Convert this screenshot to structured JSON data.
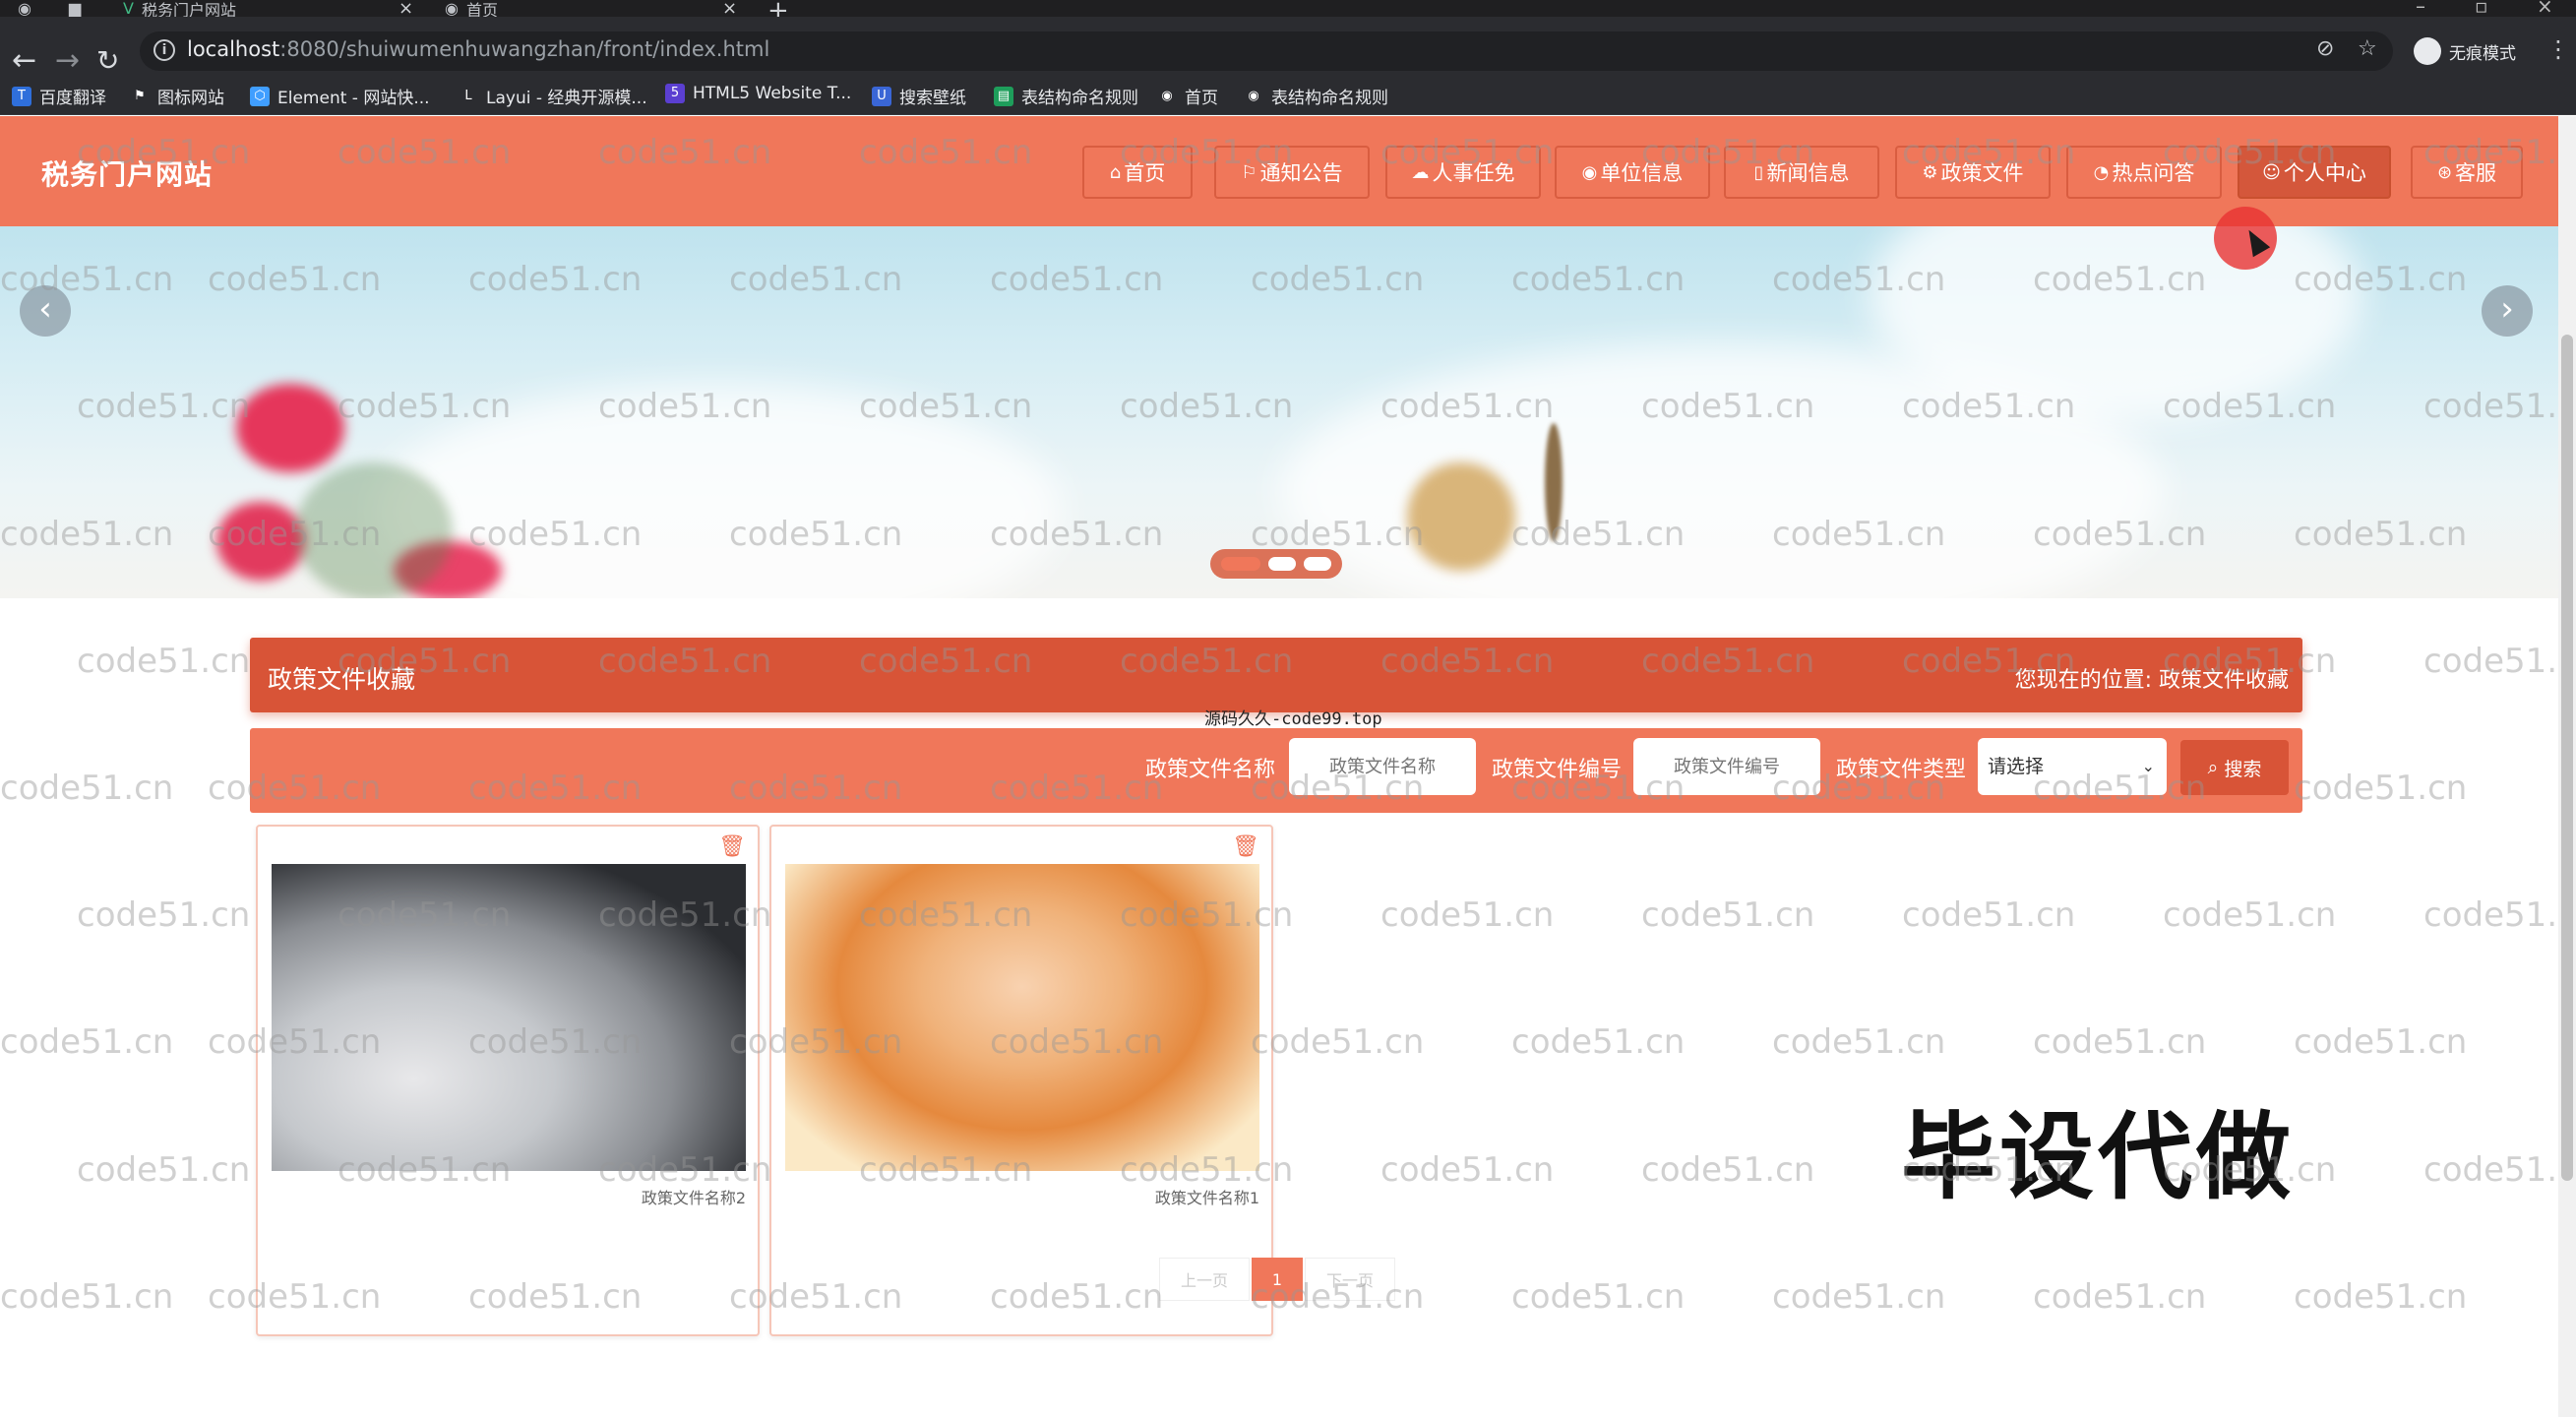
{
  "browser": {
    "tabs": [
      {
        "title": "税务门户网站"
      },
      {
        "title": "首页"
      }
    ],
    "url_host": "localhost",
    "url_rest": ":8080/shuiwumenhuwangzhan/front/index.html",
    "profile_label": "无痕模式",
    "bookmarks": [
      {
        "label": "百度翻译",
        "icon": "baidu-translate-icon",
        "color": "#2f6fdb"
      },
      {
        "label": "图标网站",
        "icon": "flag-icon",
        "color": "#2b2c30"
      },
      {
        "label": "Element - 网站快...",
        "icon": "element-icon",
        "color": "#409eff"
      },
      {
        "label": "Layui - 经典开源模...",
        "icon": "layui-icon",
        "color": "#2b2c30"
      },
      {
        "label": "HTML5 Website T...",
        "icon": "html5-icon",
        "color": "#5b3fd1"
      },
      {
        "label": "搜索壁纸",
        "icon": "wallpaper-icon",
        "color": "#3a66d6"
      },
      {
        "label": "表结构命名规则",
        "icon": "sheet-icon",
        "color": "#1e9e5b"
      },
      {
        "label": "首页",
        "icon": "globe-icon",
        "color": "#2b2c30"
      },
      {
        "label": "表结构命名规则",
        "icon": "globe-icon",
        "color": "#2b2c30"
      }
    ]
  },
  "site": {
    "logo": "税务门户网站",
    "accent": "#f0775a",
    "accent_dark": "#d85437",
    "nav": [
      {
        "label": "首页",
        "icon": "home-icon",
        "glyph": "⌂"
      },
      {
        "label": "通知公告",
        "icon": "flag-icon",
        "glyph": "⚐"
      },
      {
        "label": "人事任免",
        "icon": "cloud-icon",
        "glyph": "☁"
      },
      {
        "label": "单位信息",
        "icon": "globe-icon",
        "glyph": "◉"
      },
      {
        "label": "新闻信息",
        "icon": "document-icon",
        "glyph": "▯"
      },
      {
        "label": "政策文件",
        "icon": "gear-icon",
        "glyph": "⚙"
      },
      {
        "label": "热点问答",
        "icon": "clock-icon",
        "glyph": "◔"
      },
      {
        "label": "个人中心",
        "icon": "user-icon",
        "glyph": "☺",
        "active": true
      },
      {
        "label": "客服",
        "icon": "support-icon",
        "glyph": "⊛"
      }
    ]
  },
  "banner": {
    "prev": "‹",
    "next": "›",
    "slide_count": 3,
    "active_slide": 1
  },
  "section": {
    "title": "政策文件收藏",
    "location_prefix": "您现在的位置:",
    "location_current": "政策文件收藏"
  },
  "source_note": "源码久久-code99.top",
  "search": {
    "name_label": "政策文件名称",
    "name_placeholder": "政策文件名称",
    "code_label": "政策文件编号",
    "code_placeholder": "政策文件编号",
    "type_label": "政策文件类型",
    "type_selected": "请选择",
    "button": "搜索"
  },
  "cards": [
    {
      "caption": "政策文件名称2",
      "image": "husky"
    },
    {
      "caption": "政策文件名称1",
      "image": "girl"
    }
  ],
  "pagination": {
    "prev": "上一页",
    "current": "1",
    "next": "下一页"
  },
  "overlay_text": "毕设代做",
  "watermark": "code51.cn"
}
